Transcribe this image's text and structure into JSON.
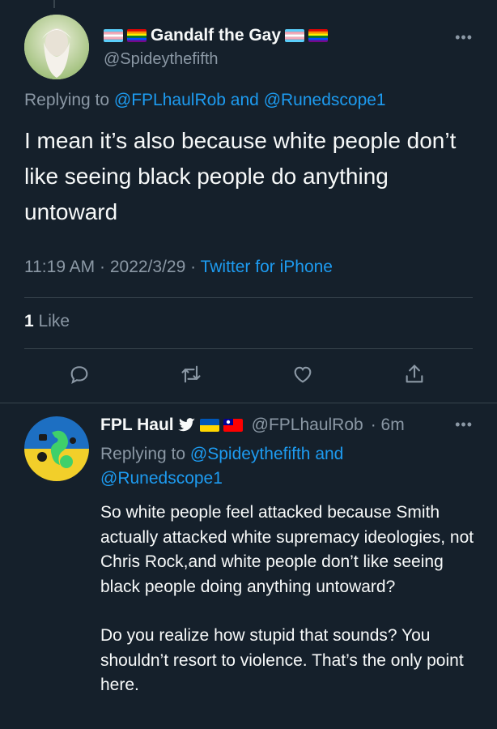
{
  "tweet": {
    "display_name": "Gandalf the Gay",
    "handle": "@Spideythefifth",
    "replying_prefix": "Replying to ",
    "replying_to_1": "@FPLhaulRob",
    "replying_and": " and ",
    "replying_to_2": "@Runedscope1",
    "text": "I mean it’s also because white people don’t like seeing black people do anything untoward",
    "time": "11:19 AM",
    "date": "2022/3/29",
    "meta_sep": " · ",
    "client": "Twitter for iPhone",
    "like_count": "1",
    "like_label": " Like",
    "more_label": "•••"
  },
  "reply": {
    "display_name": "FPL Haul",
    "handle": "@FPLhaulRob",
    "time_ago": "· 6m",
    "replying_prefix": "Replying to ",
    "replying_to_1": "@Spideythefifth",
    "replying_and": " and",
    "replying_to_2": "@Runedscope1",
    "paragraph_1": "So white people feel attacked because Smith actually attacked white supremacy ideologies, not Chris Rock,and white people don’t like seeing black people doing anything untoward?",
    "paragraph_2": "Do you realize how stupid that sounds? You shouldn’t resort to violence. That’s the only point here.",
    "more_label": "•••"
  },
  "colors": {
    "background": "#15202b",
    "text": "#f7f9f9",
    "secondary": "#8b98a5",
    "link": "#1d9bf0",
    "divider": "#38444d"
  },
  "icons": [
    "reply-icon",
    "retweet-icon",
    "like-icon",
    "share-icon",
    "twitter-bird-icon",
    "ukraine-flag-icon",
    "taiwan-flag-icon",
    "pride-flag-icon",
    "trans-flag-icon"
  ]
}
